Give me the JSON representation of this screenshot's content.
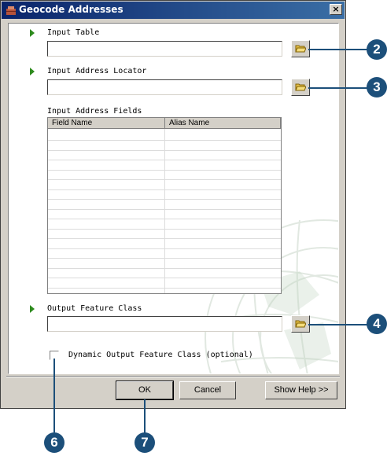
{
  "window": {
    "title": "Geocode Addresses",
    "close_glyph": "×"
  },
  "params": {
    "input_table": {
      "label": "Input Table",
      "value": "",
      "icon": "open-folder-icon"
    },
    "input_locator": {
      "label": "Input Address Locator",
      "value": "",
      "icon": "open-folder-icon"
    },
    "fields": {
      "label": "Input Address Fields",
      "columns": [
        "Field Name",
        "Alias Name"
      ],
      "rows": []
    },
    "output_fc": {
      "label": "Output Feature Class",
      "value": "",
      "icon": "open-folder-icon"
    },
    "dynamic_output": {
      "label": "Dynamic Output Feature Class (optional)",
      "checked": false
    }
  },
  "buttons": {
    "ok": "OK",
    "cancel": "Cancel",
    "help": "Show Help >>"
  },
  "callouts": [
    "2",
    "3",
    "4",
    "6",
    "7"
  ],
  "colors": {
    "title_bar": "#0a246a",
    "required_arrow": "#2e8b1e",
    "callout": "#1c4f7a"
  }
}
